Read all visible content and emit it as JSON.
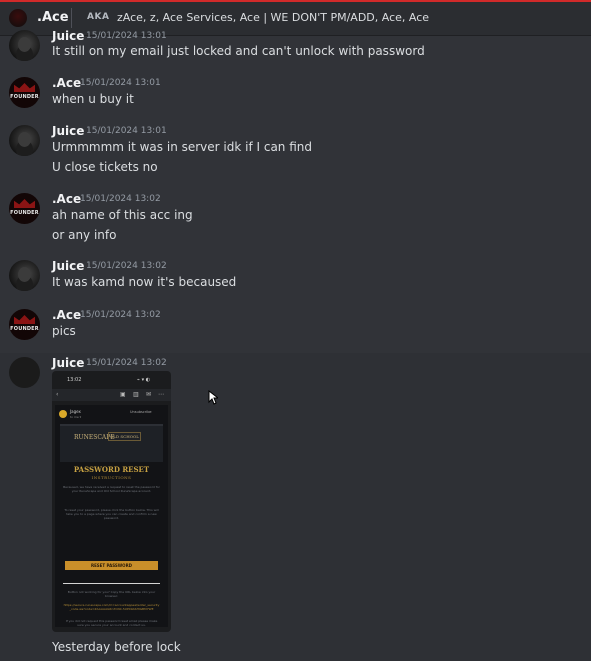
{
  "header": {
    "channel_name": ".Ace",
    "aka_label": "AKA",
    "aka_names": "zAce, z, Ace Services, Ace | WE DON'T PM/ADD, Ace, Ace"
  },
  "messages": [
    {
      "author": "Juice",
      "timestamp": "15/01/2024 13:01",
      "lines": [
        "It still on my email just locked and can't unlock with password"
      ]
    },
    {
      "author": ".Ace",
      "timestamp": "15/01/2024 13:01",
      "lines": [
        "when u buy it"
      ]
    },
    {
      "author": "Juice",
      "timestamp": "15/01/2024 13:01",
      "lines": [
        "Urmmmmm it was in server idk if I can find",
        "U close tickets no"
      ]
    },
    {
      "author": ".Ace",
      "timestamp": "15/01/2024 13:02",
      "lines": [
        "ah name of this acc ing",
        "or any info"
      ]
    },
    {
      "author": "Juice",
      "timestamp": "15/01/2024 13:02",
      "lines": [
        "It was kamd now it's becaused"
      ]
    },
    {
      "author": ".Ace",
      "timestamp": "15/01/2024 13:02",
      "lines": [
        "pics"
      ]
    },
    {
      "author": "Juice",
      "timestamp": "15/01/2024 13:02",
      "lines": [
        "Yesterday before lock"
      ]
    }
  ],
  "avatar_badge": "FOUNDER",
  "attachment": {
    "status_time": "13:02",
    "status_icons": "⌁ ▾ ◐",
    "mail_from": "Jagex",
    "mail_to": "to me ▾",
    "show_line": "Unsubscribe",
    "logo_left": "RUNESCAPE",
    "logo_right": "OLD SCHOOL",
    "title": "PASSWORD RESET",
    "subtitle": "INSTRUCTIONS",
    "greeting": "Becaused, we have received a request to reset the password for your RuneScape and Old School RuneScape account.",
    "body": "To reset your password, please click the button below. This will take you to a page where you can create and confirm a new password.",
    "button_label": "RESET PASSWORD",
    "fallback": "Button not working for you? Copy the URL below into your browser:",
    "url": "https://secure.runescape.com/m=accountappeal/enter_security_code.ws?code=ZAAAAAGRn7CNC-5UP09ASHIGBM7WE",
    "footer": "If you did not request this password reset email please make sure you secure your account and contact us."
  }
}
